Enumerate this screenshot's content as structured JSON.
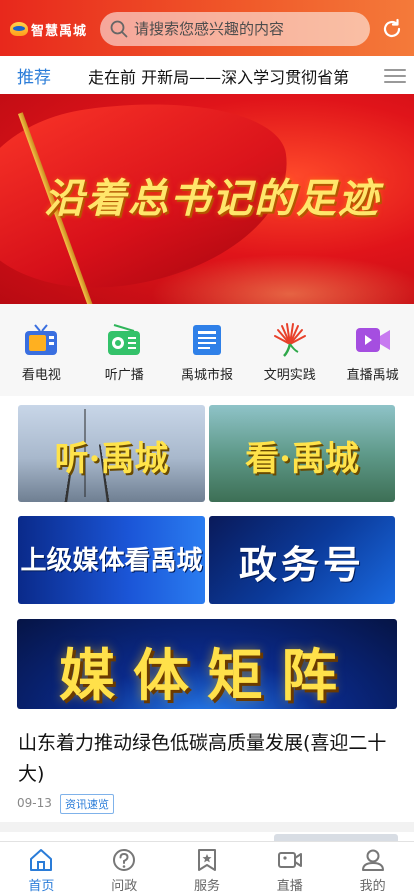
{
  "colors": {
    "brand_red": "#e8281c",
    "accent_blue": "#2a7cd8",
    "text_dark": "#111111",
    "text_muted": "#888888"
  },
  "header": {
    "logo_text": "智慧禹城",
    "search_placeholder": "请搜索您感兴趣的内容",
    "refresh_icon": "refresh-icon"
  },
  "tabs": {
    "active": "推荐",
    "ticker": "走在前 开新局——深入学习贯彻省第"
  },
  "banner": {
    "slogan": "沿着总书记的足迹"
  },
  "quicknav": [
    {
      "label": "看电视",
      "icon": "tv-icon"
    },
    {
      "label": "听广播",
      "icon": "radio-icon"
    },
    {
      "label": "禹城市报",
      "icon": "newspaper-icon"
    },
    {
      "label": "文明实践",
      "icon": "civilization-icon"
    },
    {
      "label": "直播禹城",
      "icon": "video-icon"
    }
  ],
  "cards": {
    "listen": "听·禹城",
    "watch": "看·禹城",
    "media": "上级媒体看禹城",
    "gov": "政务号",
    "matrix": "媒体矩阵"
  },
  "article": {
    "title": "山东着力推动绿色低碳高质量发展(喜迎二十大)",
    "date": "09-13",
    "tag": "资讯速览"
  },
  "bottomnav": [
    {
      "label": "首页",
      "icon": "home-icon",
      "active": true
    },
    {
      "label": "问政",
      "icon": "question-icon",
      "active": false
    },
    {
      "label": "服务",
      "icon": "service-icon",
      "active": false
    },
    {
      "label": "直播",
      "icon": "video-camera-icon",
      "active": false
    },
    {
      "label": "我的",
      "icon": "user-icon",
      "active": false
    }
  ]
}
